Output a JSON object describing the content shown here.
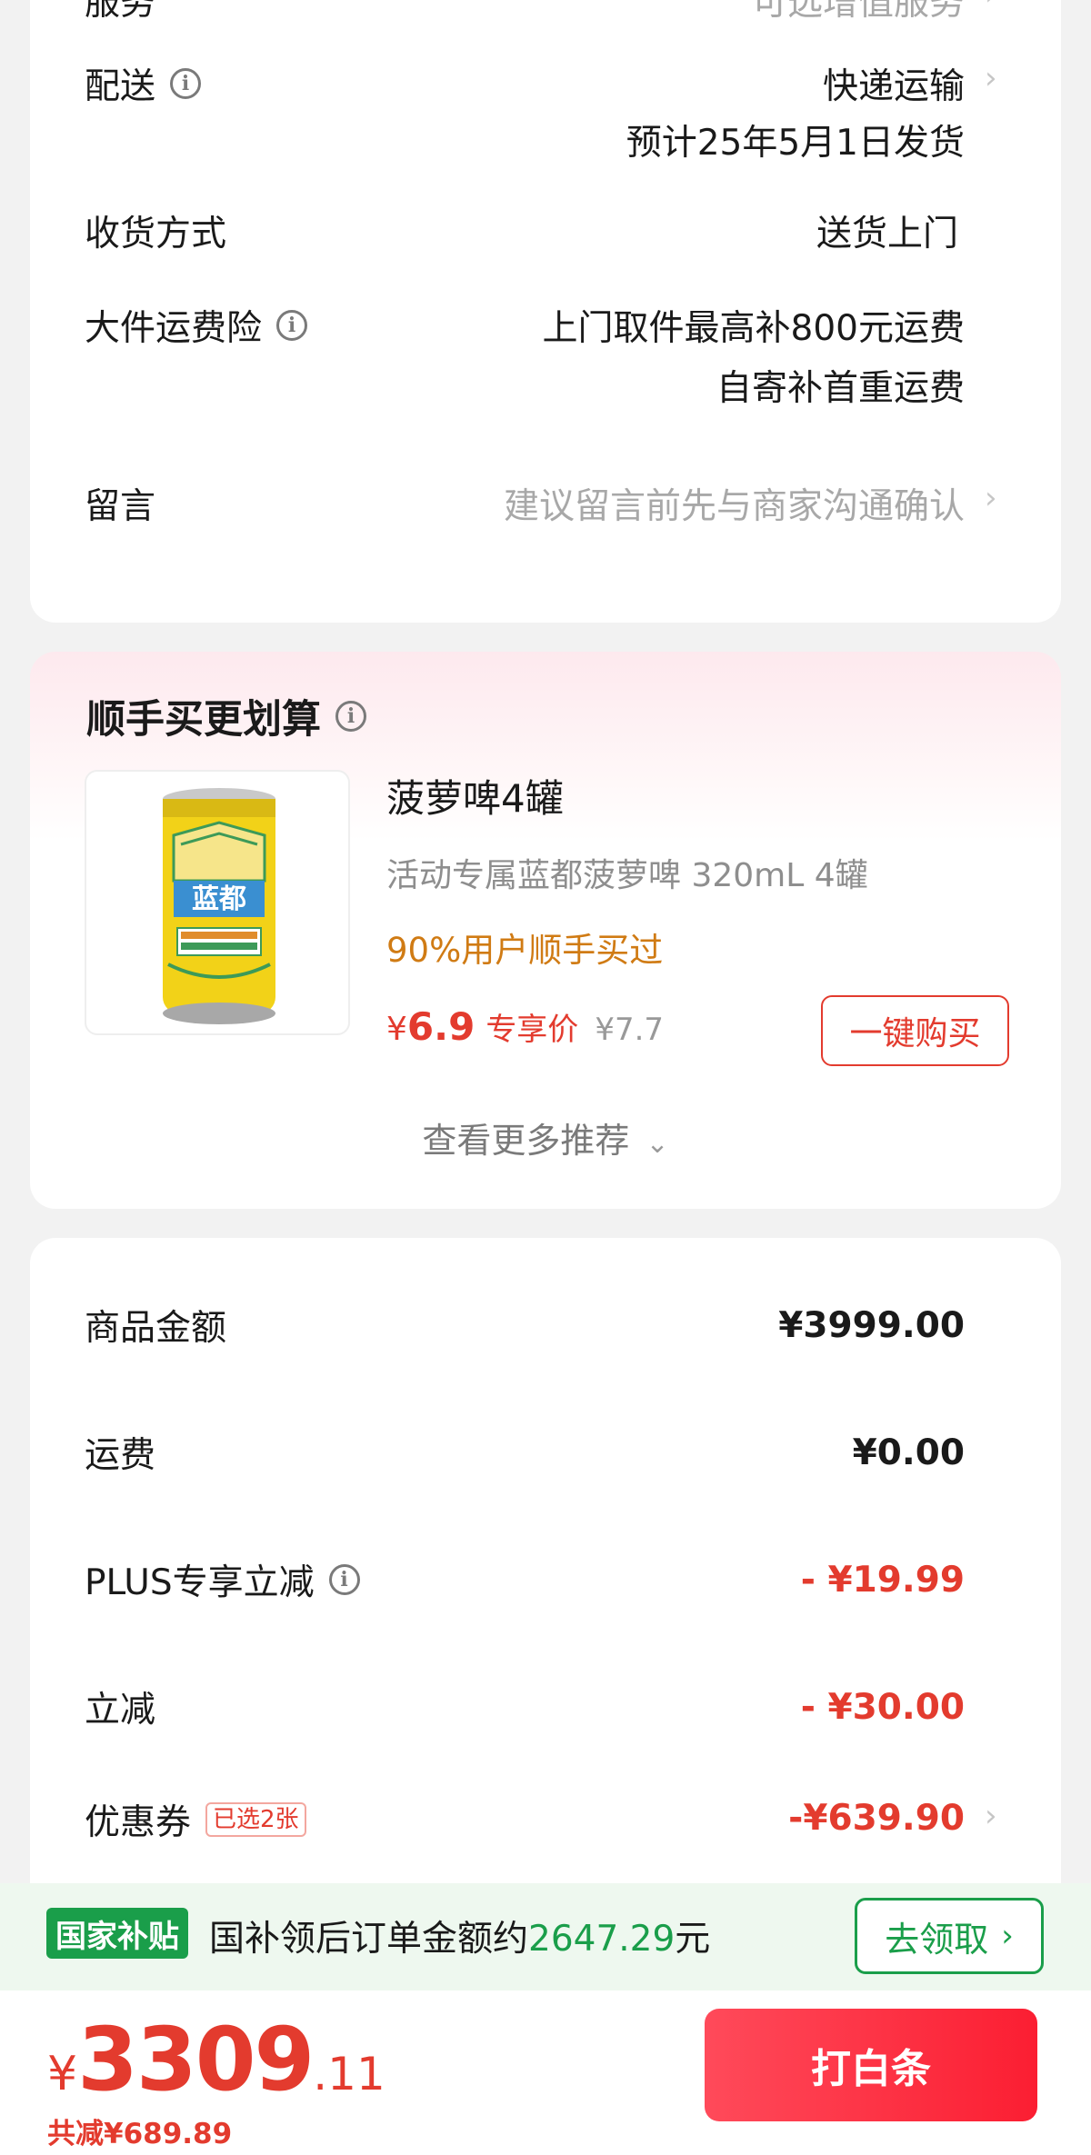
{
  "order_info": {
    "service": {
      "label": "服务",
      "value": "可选增值服务"
    },
    "delivery": {
      "label": "配送",
      "value": "快递运输",
      "estimate": "预计25年5月1日发货"
    },
    "receive": {
      "label": "收货方式",
      "value": "送货上门"
    },
    "insurance": {
      "label": "大件运费险",
      "line1": "上门取件最高补800元运费",
      "line2": "自寄补首重运费"
    },
    "message": {
      "label": "留言",
      "placeholder": "建议留言前先与商家沟通确认"
    }
  },
  "recommend": {
    "title": "顺手买更划算",
    "product": {
      "name": "菠萝啤4罐",
      "desc": "活动专属蓝都菠萝啤  320mL 4罐",
      "hot": "90%用户顺手买过",
      "currency": "¥",
      "price": "6.9",
      "price_tag": "专享价",
      "orig_price": "¥7.7",
      "image_brand": "蓝都"
    },
    "buy_label": "一键购买",
    "more_label": "查看更多推荐"
  },
  "summary": {
    "goods": {
      "label": "商品金额",
      "value": "¥3999.00"
    },
    "shipping": {
      "label": "运费",
      "value": "¥0.00"
    },
    "plus": {
      "label": "PLUS专享立减",
      "value": "- ¥19.99"
    },
    "instant": {
      "label": "立减",
      "value": "- ¥30.00"
    },
    "coupon": {
      "label": "优惠券",
      "tag": "已选2张",
      "value": "-¥639.90"
    }
  },
  "subsidy": {
    "badge": "国家补贴",
    "text_prefix": "国补领后订单金额约",
    "amount": "2647.29",
    "text_suffix": "元",
    "button": "去领取"
  },
  "bottom": {
    "currency": "¥",
    "total_int": "3309",
    "total_dec": ".11",
    "saved": "共减¥689.89",
    "pay_label": "打白条"
  },
  "colors": {
    "accent_red": "#e33b2e",
    "subsidy_green": "#1a9e4a",
    "hot_orange": "#d07b14"
  }
}
